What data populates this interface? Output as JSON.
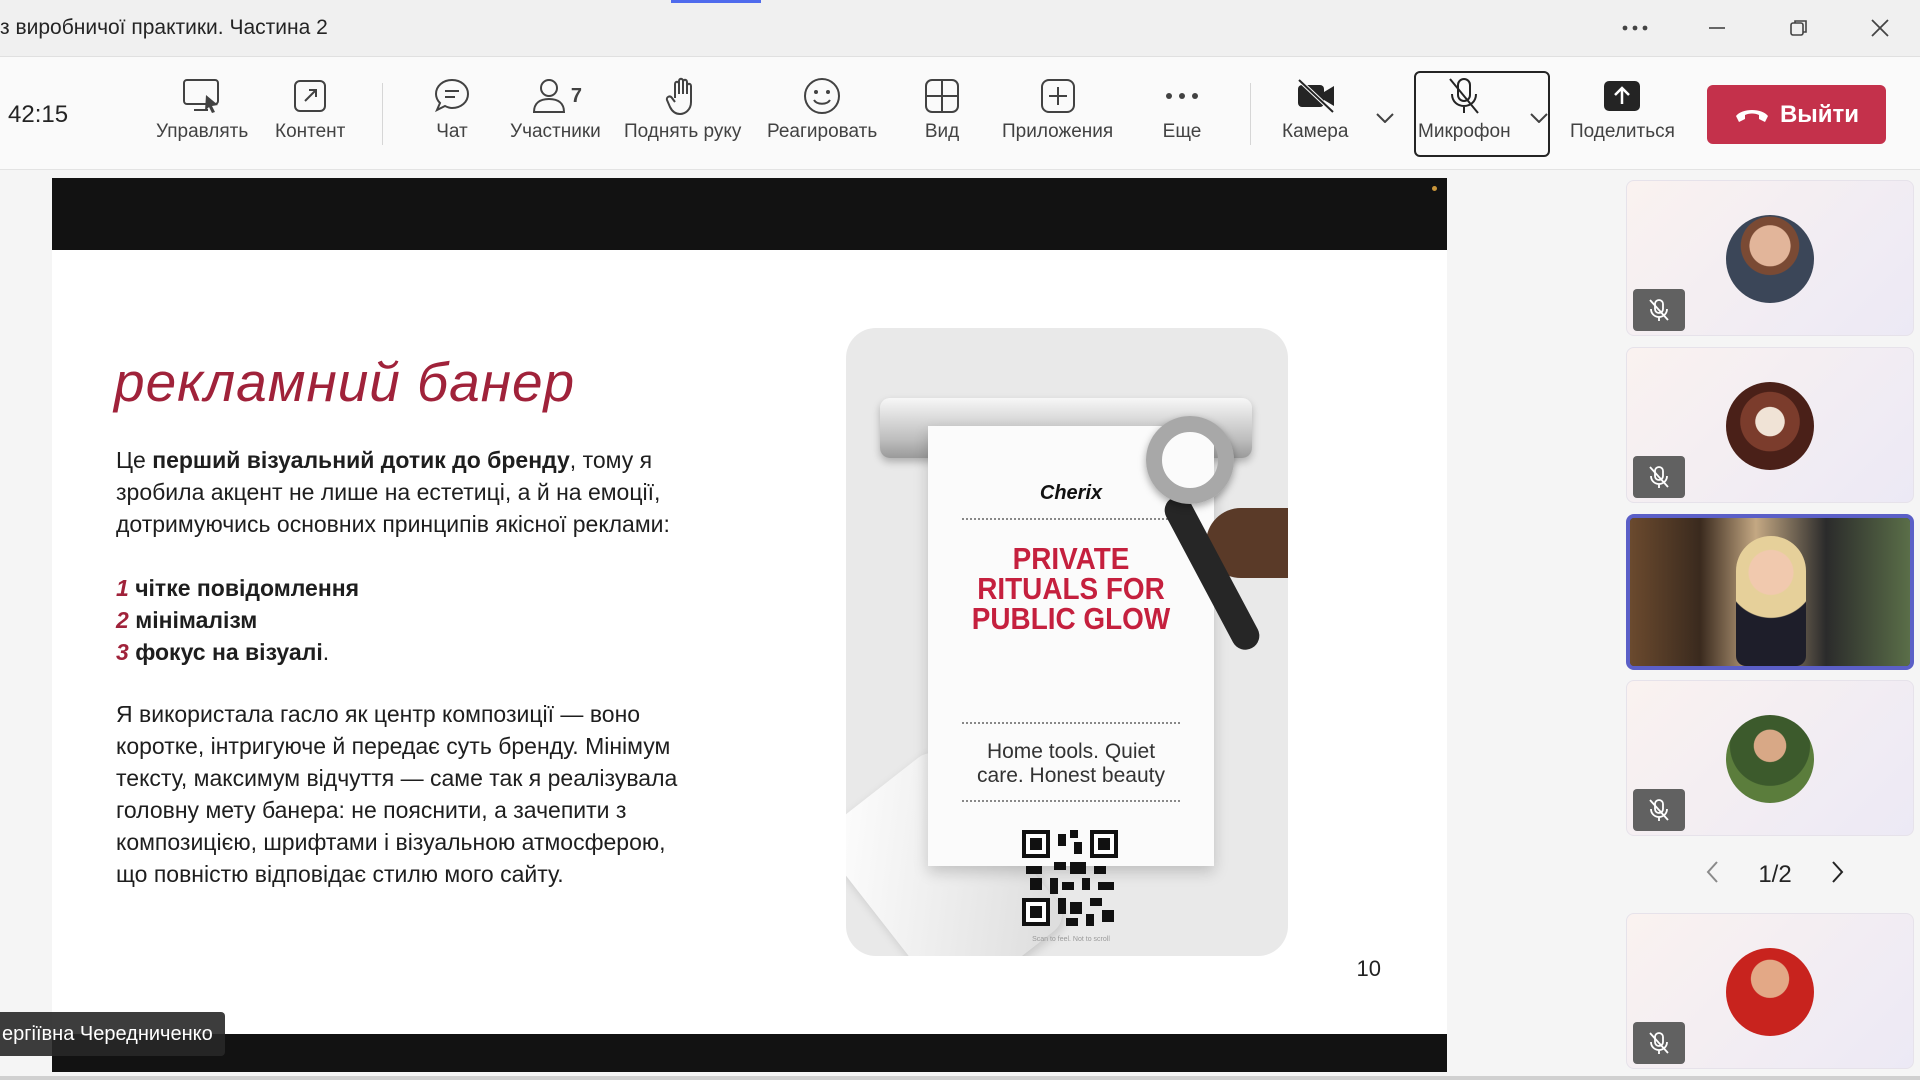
{
  "window": {
    "title": "з виробничої практики. Частина 2"
  },
  "toolbar": {
    "timer": "42:15",
    "buttons": {
      "manage": "Управлять",
      "content": "Контент",
      "chat": "Чат",
      "participants": "Участники",
      "participants_count": "7",
      "raise_hand": "Поднять руку",
      "react": "Реагировать",
      "view": "Вид",
      "apps": "Приложения",
      "more": "Еще",
      "camera": "Камера",
      "mic": "Микрофон",
      "share": "Поделиться",
      "leave": "Выйти"
    }
  },
  "slide": {
    "heading": "рекламний банер",
    "intro_plain_1": "Це ",
    "intro_bold": "перший візуальний дотик до бренду",
    "intro_plain_2": ", тому я",
    "intro_line_2": "зробила акцент не лише на естетиці, а й на емоції,",
    "intro_line_3": "дотримуючись основних принципів якісної реклами:",
    "principles": [
      {
        "num": "1",
        "text": "чітке повідомлення"
      },
      {
        "num": "2",
        "text": "мінімалізм"
      },
      {
        "num": "3",
        "text": "фокус на візуалі"
      }
    ],
    "principle_3_suffix": ".",
    "body_lines": [
      "Я використала гасло як центр композиції — воно",
      "коротке, інтригуюче й передає суть бренду. Мінімум",
      "тексту, максимум відчуття — саме так я реалізувала",
      "головну мету банера: не пояснити, а зачепити з",
      "композицією, шрифтами і візуальною атмосферою,",
      "що повністю відповідає стилю мого сайту."
    ],
    "page_number": "10",
    "poster": {
      "brand": "Cherix",
      "headline_lines": [
        "PRIVATE",
        "RITUALS FOR",
        "PUBLIC GLOW"
      ],
      "sub_lines": [
        "Home tools. Quiet",
        "care. Honest beauty"
      ],
      "tiny": "Scan to feel. Not to scroll"
    }
  },
  "presenter_name": "ергіївна Чередниченко",
  "pager": {
    "label": "1/2"
  },
  "colors": {
    "accent": "#5b5fc7",
    "leave": "#c4314b",
    "heading": "#a0223a",
    "poster_red": "#c5203e"
  }
}
